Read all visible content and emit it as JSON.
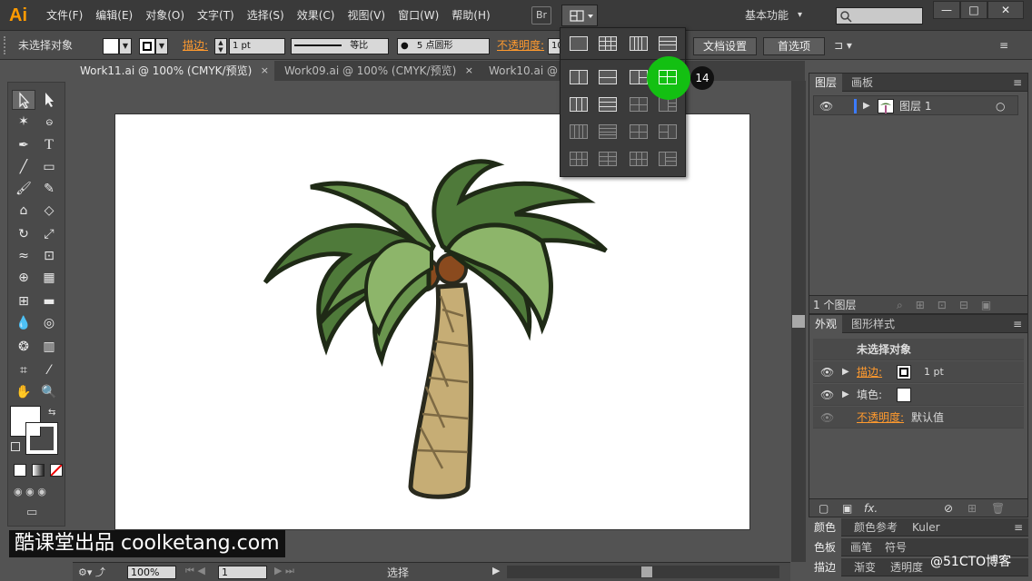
{
  "app": {
    "logo": "Ai"
  },
  "menu": {
    "items": [
      "文件(F)",
      "编辑(E)",
      "对象(O)",
      "文字(T)",
      "选择(S)",
      "效果(C)",
      "视图(V)",
      "窗口(W)",
      "帮助(H)"
    ]
  },
  "menubar": {
    "bridge_label": "Br",
    "workspace": "基本功能",
    "workspace_arrow": "▾",
    "search_icon": "🔍"
  },
  "window_controls": {
    "minimize": "—",
    "restore": "□",
    "close": "✕"
  },
  "control_bar": {
    "selection_label": "未选择对象",
    "stroke_label": "描边:",
    "stroke_weight": "1 pt",
    "stroke_profile_label": "等比",
    "brush_label": "5 点圆形",
    "opacity_label": "不透明度:",
    "opacity_value": "10",
    "doc_setup": "文档设置",
    "preferences": "首选项"
  },
  "tabs": [
    {
      "label": "Work11.ai @ 100% (CMYK/预览)",
      "close": "×"
    },
    {
      "label": "Work09.ai @ 100% (CMYK/预览)",
      "close": "×"
    },
    {
      "label": "Work10.ai @ 10",
      "close": ""
    }
  ],
  "arrange_step": "14",
  "layers_panel": {
    "tabs": [
      "图层",
      "画板"
    ],
    "layer_name": "图层 1",
    "footer": "1 个图层"
  },
  "appearance_panel": {
    "tabs": [
      "外观",
      "图形样式"
    ],
    "title": "未选择对象",
    "stroke_label": "描边:",
    "stroke_value": "1 pt",
    "fill_label": "填色:",
    "opacity_label": "不透明度:",
    "opacity_value": "默认值",
    "fx": "fx."
  },
  "color_panel": {
    "tabs": [
      "颜色",
      "颜色参考",
      "Kuler"
    ]
  },
  "swatch_panel": {
    "tabs": [
      "色板",
      "画笔",
      "符号"
    ]
  },
  "stroke_panel": {
    "tabs": [
      "描边",
      "渐变",
      "透明度"
    ]
  },
  "status": {
    "zoom": "100%",
    "page": "1",
    "tool": "选择"
  },
  "watermark": {
    "main": "酷课堂出品 coolketang.com",
    "corner": "@51CTO博客"
  },
  "colors": {
    "accent_orange": "#ff9a2e",
    "highlight_green": "#13c012",
    "leaf_dark": "#4f7a3a",
    "leaf_light": "#8db56a",
    "trunk": "#c6ad75",
    "coconut": "#8a4a1e"
  }
}
